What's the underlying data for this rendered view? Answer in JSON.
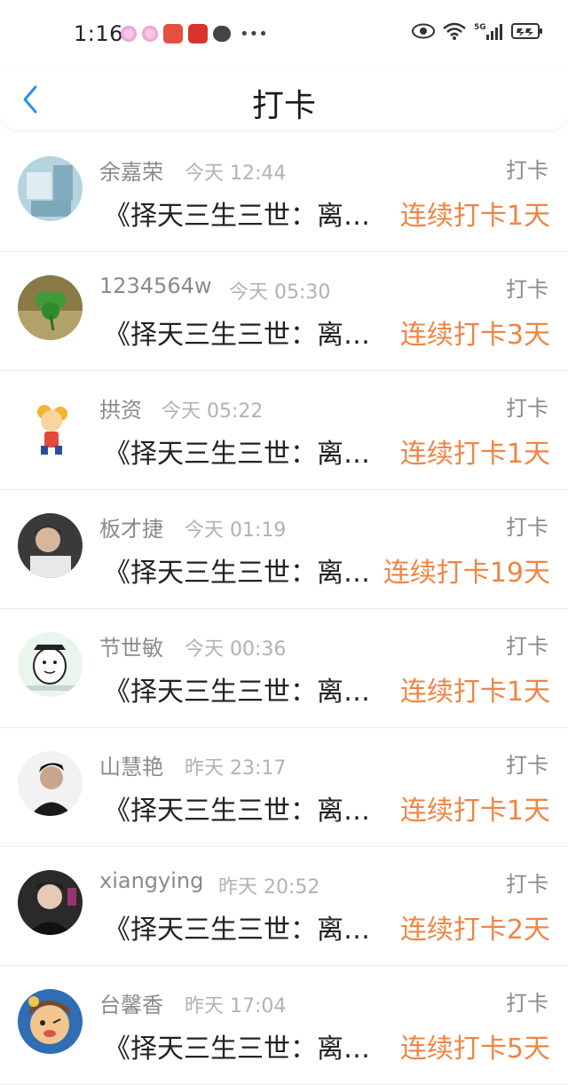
{
  "status_bar": {
    "time": "1:16",
    "icons": [
      "flower-icon",
      "flower-icon",
      "huawei-app-icon",
      "gift-app-icon",
      "chat-icon",
      "more-dots",
      "eye-icon",
      "wifi-icon",
      "5g-signal-icon",
      "battery-icon"
    ],
    "network": "5G"
  },
  "header": {
    "title": "打卡",
    "back_icon": "chevron-left-icon",
    "accent": "#2d8ee8"
  },
  "list": [
    {
      "name": "余嘉荣",
      "time": "今天 12:44",
      "tag": "打卡",
      "book": "《择天三生三世：离…",
      "streak": "连续打卡1天"
    },
    {
      "name": "1234564w",
      "time": "今天 05:30",
      "tag": "打卡",
      "book": "《择天三生三世：离…",
      "streak": "连续打卡3天"
    },
    {
      "name": "拱资",
      "time": "今天 05:22",
      "tag": "打卡",
      "book": "《择天三生三世：离…",
      "streak": "连续打卡1天"
    },
    {
      "name": "板才捷",
      "time": "今天 01:19",
      "tag": "打卡",
      "book": "《择天三生三世：离…",
      "streak": "连续打卡19天"
    },
    {
      "name": "节世敏",
      "time": "今天 00:36",
      "tag": "打卡",
      "book": "《择天三生三世：离…",
      "streak": "连续打卡1天"
    },
    {
      "name": "山慧艳",
      "time": "昨天 23:17",
      "tag": "打卡",
      "book": "《择天三生三世：离…",
      "streak": "连续打卡1天"
    },
    {
      "name": "xiangying",
      "time": "昨天 20:52",
      "tag": "打卡",
      "book": "《择天三生三世：离…",
      "streak": "连续打卡2天"
    },
    {
      "name": "台馨香",
      "time": "昨天 17:04",
      "tag": "打卡",
      "book": "《择天三生三世：离…",
      "streak": "连续打卡5天"
    }
  ],
  "colors": {
    "streak": "#ef8545",
    "name": "#8a8a8a",
    "time": "#b2b2b2",
    "book": "#222222"
  }
}
